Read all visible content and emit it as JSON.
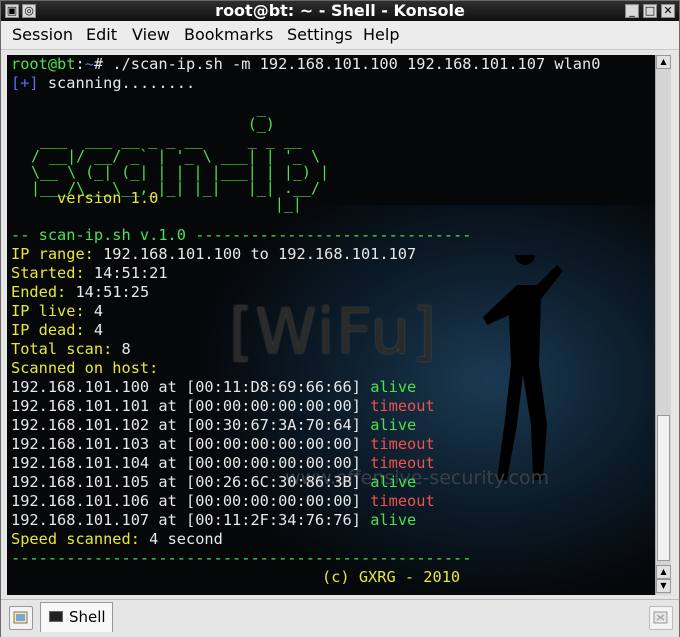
{
  "window": {
    "title": "root@bt: ~ - Shell - Konsole"
  },
  "menubar": {
    "items": [
      "Session",
      "Edit",
      "View",
      "Bookmarks",
      "Settings",
      "Help"
    ]
  },
  "terminal": {
    "prompt_user": "root@bt",
    "prompt_sep": ":",
    "prompt_path": "~",
    "prompt_end": "# ",
    "command": "./scan-ip.sh -m 192.168.101.100 192.168.101.107 wlan0",
    "scan_marker": "[+]",
    "scan_text": " scanning........",
    "ascii_art": "                         _\n                        (_)\n ___  ___ __ _ _ __     _ _ __\n/ __|/ __/ _` | '_ \\ ___| | '_ \\\n\\__ \\ (_| (_| | | | |___| | |_) |\n|___/\\___\\__,_|_| |_|   |_| .__/\n                           |_|",
    "version": "version 1.0",
    "header_line": "-- scan-ip.sh v.1.0 ------------------------------",
    "ip_range_label": "IP range:",
    "ip_range_value": " 192.168.101.100 to 192.168.101.107",
    "started_label": "Started:",
    "started_value": " 14:51:21",
    "ended_label": "Ended:",
    "ended_value": " 14:51:25",
    "ip_live_label": "IP live:",
    "ip_live_value": " 4",
    "ip_dead_label": "IP dead:",
    "ip_dead_value": " 4",
    "total_scan_label": "Total scan:",
    "total_scan_value": " 8",
    "scanned_on_host": "Scanned on host:",
    "hosts": [
      {
        "ip": "192.168.101.100",
        "mac": "[00:11:D8:69:66:66]",
        "status": "alive"
      },
      {
        "ip": "192.168.101.101",
        "mac": "[00:00:00:00:00:00]",
        "status": "timeout"
      },
      {
        "ip": "192.168.101.102",
        "mac": "[00:30:67:3A:70:64]",
        "status": "alive"
      },
      {
        "ip": "192.168.101.103",
        "mac": "[00:00:00:00:00:00]",
        "status": "timeout"
      },
      {
        "ip": "192.168.101.104",
        "mac": "[00:00:00:00:00:00]",
        "status": "timeout"
      },
      {
        "ip": "192.168.101.105",
        "mac": "[00:26:6C:30:86:3B]",
        "status": "alive"
      },
      {
        "ip": "192.168.101.106",
        "mac": "[00:00:00:00:00:00]",
        "status": "timeout"
      },
      {
        "ip": "192.168.101.107",
        "mac": "[00:11:2F:34:76:76]",
        "status": "alive"
      }
    ],
    "host_at": " at ",
    "speed_label": "Speed scanned:",
    "speed_value": " 4 second",
    "footer_line": "--------------------------------------------------",
    "copyright": "(c) GXRG - 2010",
    "watermark": "[WiFu]",
    "watermark_url": "www.offensive-security.com"
  },
  "tabs": [
    {
      "label": "Shell"
    }
  ],
  "colors": {
    "green": "#4ee04e",
    "yellow": "#e8e835",
    "red": "#f05050",
    "white": "#e8e8e8",
    "blue": "#5a6cf0"
  },
  "icons": [
    "minimize-icon",
    "maximize-icon",
    "close-icon",
    "app-menu-icon",
    "new-tab-icon",
    "terminal-icon",
    "close-tab-icon"
  ]
}
